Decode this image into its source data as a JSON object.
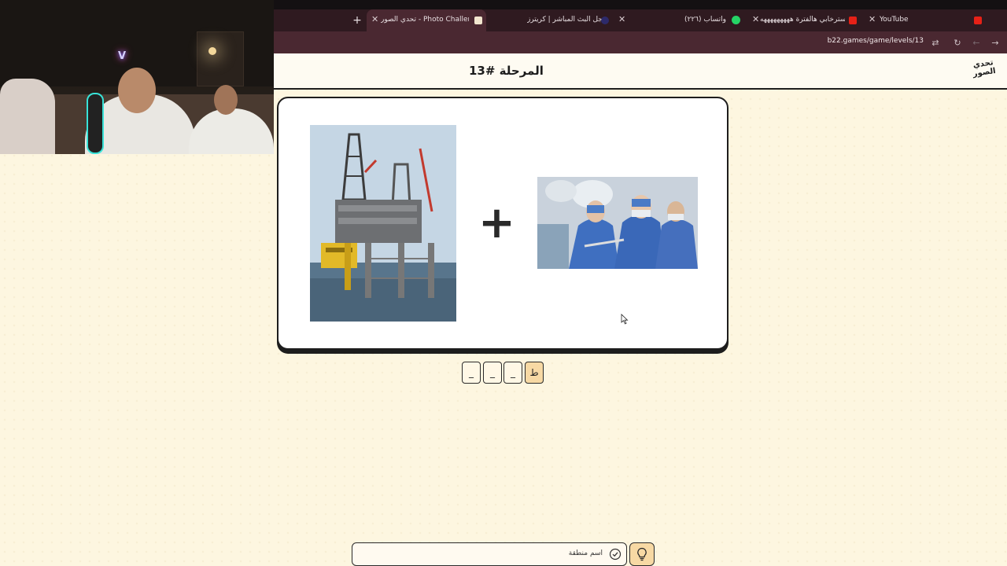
{
  "browser": {
    "url": "b22.games/game/levels/13",
    "tabs": [
      {
        "label": "YouTube",
        "favicon": "youtube-icon"
      },
      {
        "label": "استرخابي هالفترة هههههههههه",
        "favicon": "youtube-icon"
      },
      {
        "label": "(٢٢٦) واتساب",
        "favicon": "whatsapp-icon"
      },
      {
        "label": "سجل البث المباشر | كريترز",
        "favicon": "kick-icon"
      },
      {
        "label": "تحدي الصور - Photo Challenge",
        "favicon": "game-icon",
        "active": true
      }
    ],
    "new_tab_label": "+"
  },
  "webcam": {
    "neon_text": "V"
  },
  "header": {
    "level_title": "المرحلة #13",
    "logo_text_line1": "تحدي",
    "logo_text_line2": "الصور"
  },
  "puzzle": {
    "left_image": "oil-rig-photo",
    "operator": "+",
    "right_image": "surgeons-photo"
  },
  "answer": {
    "slots": [
      "ط",
      "_",
      "_",
      "_"
    ]
  },
  "hint": {
    "text": "اسم منطقة",
    "icon": "check-circle-icon",
    "bulb": "lightbulb-icon"
  },
  "colors": {
    "background": "#fdf6e0",
    "tab_bar": "#2f1a20",
    "toolbar": "#4a2831",
    "accent": "#f7d9a4"
  }
}
